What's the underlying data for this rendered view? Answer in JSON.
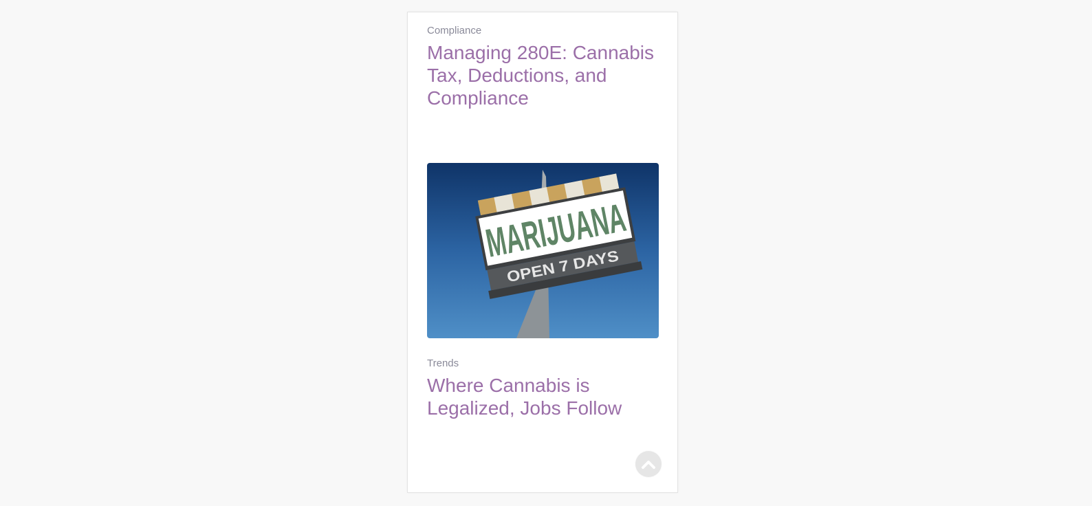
{
  "articles": [
    {
      "category": "Compliance",
      "title": "Managing 280E: Cannabis Tax, Deductions, and Compliance"
    },
    {
      "category": "Trends",
      "title": "Where Cannabis is Legalized, Jobs Follow"
    }
  ],
  "image": {
    "sign_text": "MARIJUANA",
    "sign_subtext": "OPEN 7 DAYS"
  },
  "colors": {
    "title": "#9b6fa8",
    "category": "#8a8a99",
    "background": "#f8f8f8",
    "sky": "#2f6fae"
  },
  "scroll_top_icon": "chevron-up-icon"
}
